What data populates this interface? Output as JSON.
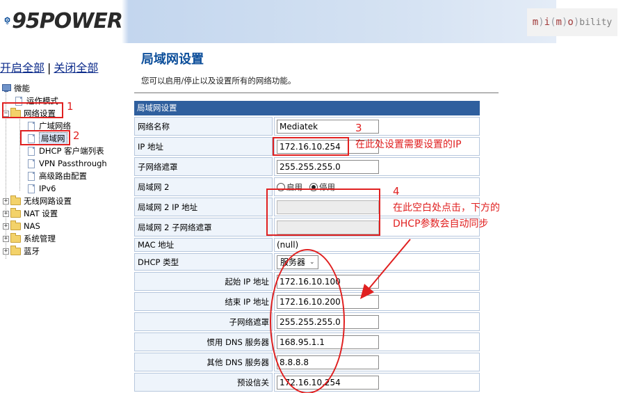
{
  "header": {
    "brand": "95POWER",
    "partner_logo": {
      "m1": "m",
      "i": "i",
      "m2": "m",
      "o": "o",
      "tail": "bility"
    }
  },
  "topnav": {
    "open_all": "开启全部",
    "separator": "|",
    "close_all": "关闭全部"
  },
  "tree": {
    "root": "微能",
    "items": [
      {
        "label": "运作模式"
      },
      {
        "label": "网络设置"
      },
      {
        "label": "广域网络"
      },
      {
        "label": "局域网"
      },
      {
        "label": "DHCP 客户端列表"
      },
      {
        "label": "VPN Passthrough"
      },
      {
        "label": "高级路由配置"
      },
      {
        "label": "IPv6"
      },
      {
        "label": "无线网路设置"
      },
      {
        "label": "NAT 设置"
      },
      {
        "label": "NAS"
      },
      {
        "label": "系统管理"
      },
      {
        "label": "蓝牙"
      }
    ]
  },
  "page": {
    "title": "局域网设置",
    "description": "您可以启用/停止以及设置所有的网络功能。"
  },
  "table": {
    "header": "局域网设置",
    "rows": [
      {
        "label": "网络名称",
        "value": "Mediatek"
      },
      {
        "label": "IP 地址",
        "value": "172.16.10.254"
      },
      {
        "label": "子网络遮罩",
        "value": "255.255.255.0"
      },
      {
        "label": "局域网 2",
        "opt_enable": "启用",
        "opt_disable": "停用",
        "selected": "停用"
      },
      {
        "label": "局域网 2 IP 地址",
        "value": ""
      },
      {
        "label": "局域网 2 子网络遮罩",
        "value": ""
      },
      {
        "label": "MAC 地址",
        "value": "(null)"
      },
      {
        "label": "DHCP 类型",
        "value": "服务器"
      },
      {
        "label": "起始 IP 地址",
        "value": "172.16.10.100"
      },
      {
        "label": "结束 IP 地址",
        "value": "172.16.10.200"
      },
      {
        "label": "子网络遮罩",
        "value": "255.255.255.0"
      },
      {
        "label": "惯用 DNS 服务器",
        "value": "168.95.1.1"
      },
      {
        "label": "其他 DNS 服务器",
        "value": "8.8.8.8"
      },
      {
        "label": "预设信关",
        "value": "172.16.10.254"
      }
    ]
  },
  "annotations": {
    "n1": "1",
    "n2": "2",
    "n3": "3",
    "n4": "4",
    "note_ip": "在此处设置需要设置的IP",
    "note_dhcp_line1": "在此空白处点击，下方的",
    "note_dhcp_line2": "DHCP参数会自动同步"
  },
  "colors": {
    "accent": "#2f5f9e",
    "title": "#0c4e9a",
    "annotation": "#e02020"
  }
}
